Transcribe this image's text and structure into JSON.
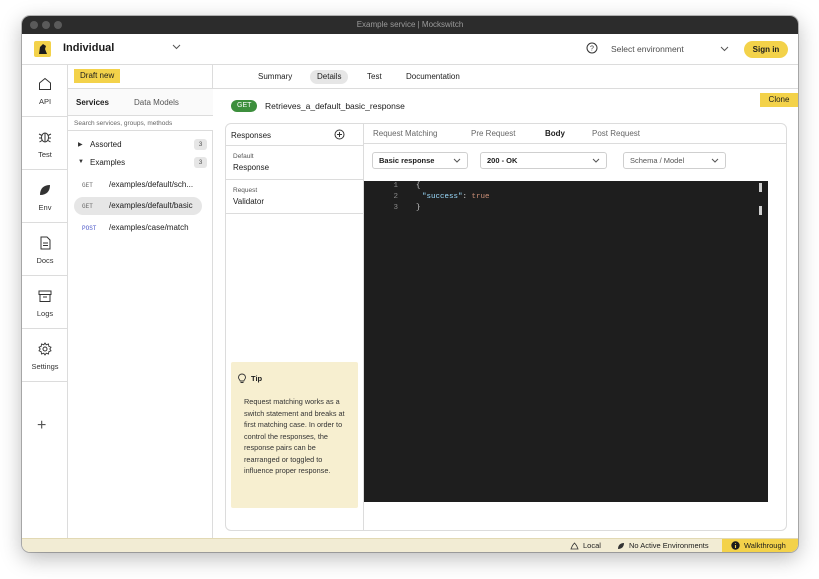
{
  "window": {
    "title": "Example service | Mockswitch"
  },
  "topbar": {
    "workspace": "Individual",
    "environment_placeholder": "Select environment",
    "sign_in": "Sign in"
  },
  "rail": {
    "items": [
      {
        "label": "API",
        "icon": "home-icon"
      },
      {
        "label": "Test",
        "icon": "bug-icon"
      },
      {
        "label": "Env",
        "icon": "leaf-icon"
      },
      {
        "label": "Docs",
        "icon": "document-icon"
      },
      {
        "label": "Logs",
        "icon": "archive-icon"
      },
      {
        "label": "Settings",
        "icon": "gear-icon"
      }
    ],
    "add": "+"
  },
  "services": {
    "draft_new": "Draft new",
    "tabs": [
      "Services",
      "Data Models"
    ],
    "search_placeholder": "Search services, groups, methods",
    "groups": [
      {
        "name": "Assorted",
        "count": "3"
      },
      {
        "name": "Examples",
        "count": "3"
      }
    ],
    "endpoints": [
      {
        "method": "GET",
        "path": "/examples/default/sch..."
      },
      {
        "method": "GET",
        "path": "/examples/default/basic"
      },
      {
        "method": "POST",
        "path": "/examples/case/match"
      }
    ]
  },
  "main": {
    "tabs": [
      "Summary",
      "Details",
      "Test",
      "Documentation"
    ],
    "method": "GET",
    "endpoint_name": "Retrieves_a_default_basic_response",
    "clone": "Clone",
    "responses": {
      "title": "Responses",
      "items": [
        {
          "small": "Default",
          "big": "Response"
        },
        {
          "small": "Request",
          "big": "Validator"
        }
      ]
    },
    "tip": {
      "title": "Tip",
      "body": "Request matching works as a switch statement and breaks at first matching case. In order to control the responses, the response pairs can be rearranged or toggled to influence proper response."
    },
    "subtabs": [
      "Request Matching",
      "Pre Request",
      "Body",
      "Post Request"
    ],
    "dropdowns": {
      "response": "Basic response",
      "status": "200 - OK",
      "schema": "Schema / Model"
    },
    "code": {
      "lines": [
        {
          "n": "1",
          "open": "{"
        },
        {
          "n": "2",
          "key": "\"success\"",
          "sep": ": ",
          "val": "true"
        },
        {
          "n": "3",
          "close": "}"
        }
      ]
    }
  },
  "statusbar": {
    "local": "Local",
    "envs": "No Active Environments",
    "walkthrough": "Walkthrough"
  },
  "colors": {
    "accent": "#f3d24a",
    "method_get": "#3d8f3d",
    "editor_bg": "#1e1e1e",
    "titlebar": "#2c2c2c"
  }
}
